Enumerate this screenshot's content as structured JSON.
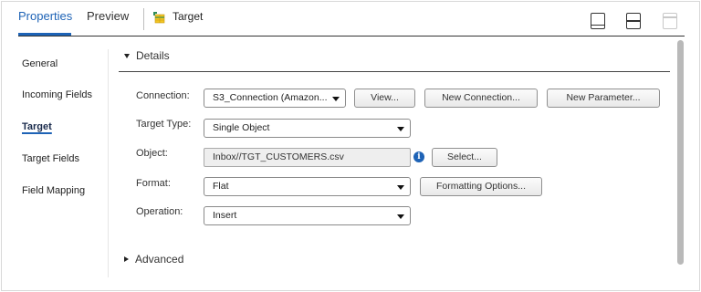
{
  "tabs": [
    {
      "label": "Properties",
      "active": true
    },
    {
      "label": "Preview",
      "active": false
    }
  ],
  "object": {
    "title": "Target",
    "icon": "table-target-icon"
  },
  "layout_buttons": [
    "panel-bottom-icon",
    "panel-split-icon",
    "panel-top-icon"
  ],
  "nav": [
    {
      "label": "General",
      "active": false
    },
    {
      "label": "Incoming Fields",
      "active": false
    },
    {
      "label": "Target",
      "active": true
    },
    {
      "label": "Target Fields",
      "active": false
    },
    {
      "label": "Field Mapping",
      "active": false
    }
  ],
  "sections": {
    "details": {
      "label": "Details",
      "expanded": true
    },
    "advanced": {
      "label": "Advanced",
      "expanded": false
    }
  },
  "form": {
    "connection": {
      "label": "Connection:",
      "value": "S3_Connection (Amazon..."
    },
    "target_type": {
      "label": "Target Type:",
      "value": "Single Object"
    },
    "object": {
      "label": "Object:",
      "value": "Inbox//TGT_CUSTOMERS.csv"
    },
    "format": {
      "label": "Format:",
      "value": "Flat"
    },
    "operation": {
      "label": "Operation:",
      "value": "Insert"
    }
  },
  "buttons": {
    "view": "View...",
    "new_connection": "New Connection...",
    "new_parameter": "New Parameter...",
    "select": "Select...",
    "formatting_options": "Formatting Options..."
  },
  "info_icon_glyph": "i",
  "colors": {
    "accent": "#1e63b6",
    "readonly_bg": "#eeeeee"
  }
}
